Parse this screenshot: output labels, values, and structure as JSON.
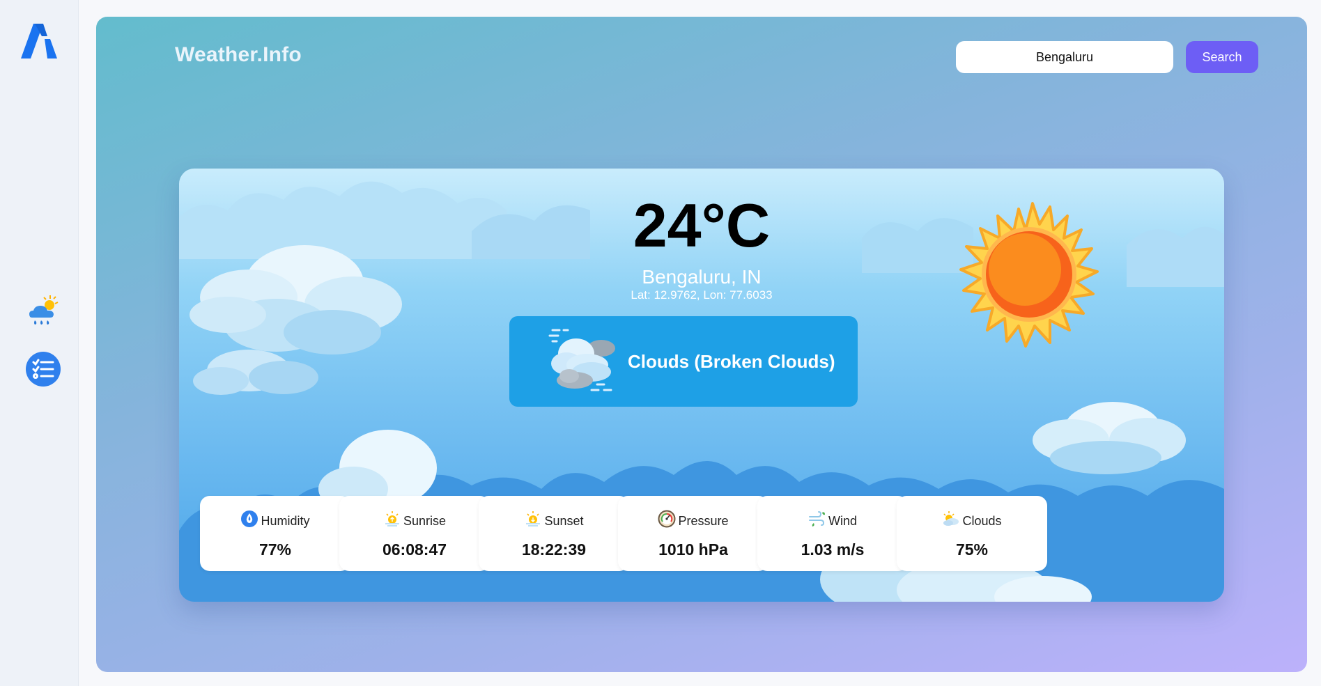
{
  "app": {
    "brand": "Weather.Info"
  },
  "sidebar": {
    "items": [
      {
        "name": "weather",
        "icon": "weather-rain-icon"
      },
      {
        "name": "list",
        "icon": "checklist-icon"
      }
    ]
  },
  "search": {
    "value": "Bengaluru",
    "button_label": "Search"
  },
  "weather": {
    "temperature": "24°C",
    "location": "Bengaluru, IN",
    "coords": "Lat: 12.9762, Lon: 77.6033",
    "condition": "Clouds (Broken Clouds)",
    "condition_icon": "broken-clouds-icon"
  },
  "stats": [
    {
      "label": "Humidity",
      "value": "77%",
      "icon": "humidity-icon"
    },
    {
      "label": "Sunrise",
      "value": "06:08:47",
      "icon": "sunrise-icon"
    },
    {
      "label": "Sunset",
      "value": "18:22:39",
      "icon": "sunset-icon"
    },
    {
      "label": "Pressure",
      "value": "1010 hPa",
      "icon": "pressure-gauge-icon"
    },
    {
      "label": "Wind",
      "value": "1.03 m/s",
      "icon": "wind-icon"
    },
    {
      "label": "Clouds",
      "value": "75%",
      "icon": "partly-cloudy-icon"
    }
  ],
  "colors": {
    "accent": "#6d5ef5",
    "condition_bg": "#1ea0e6",
    "logo": "#1a73f0"
  }
}
